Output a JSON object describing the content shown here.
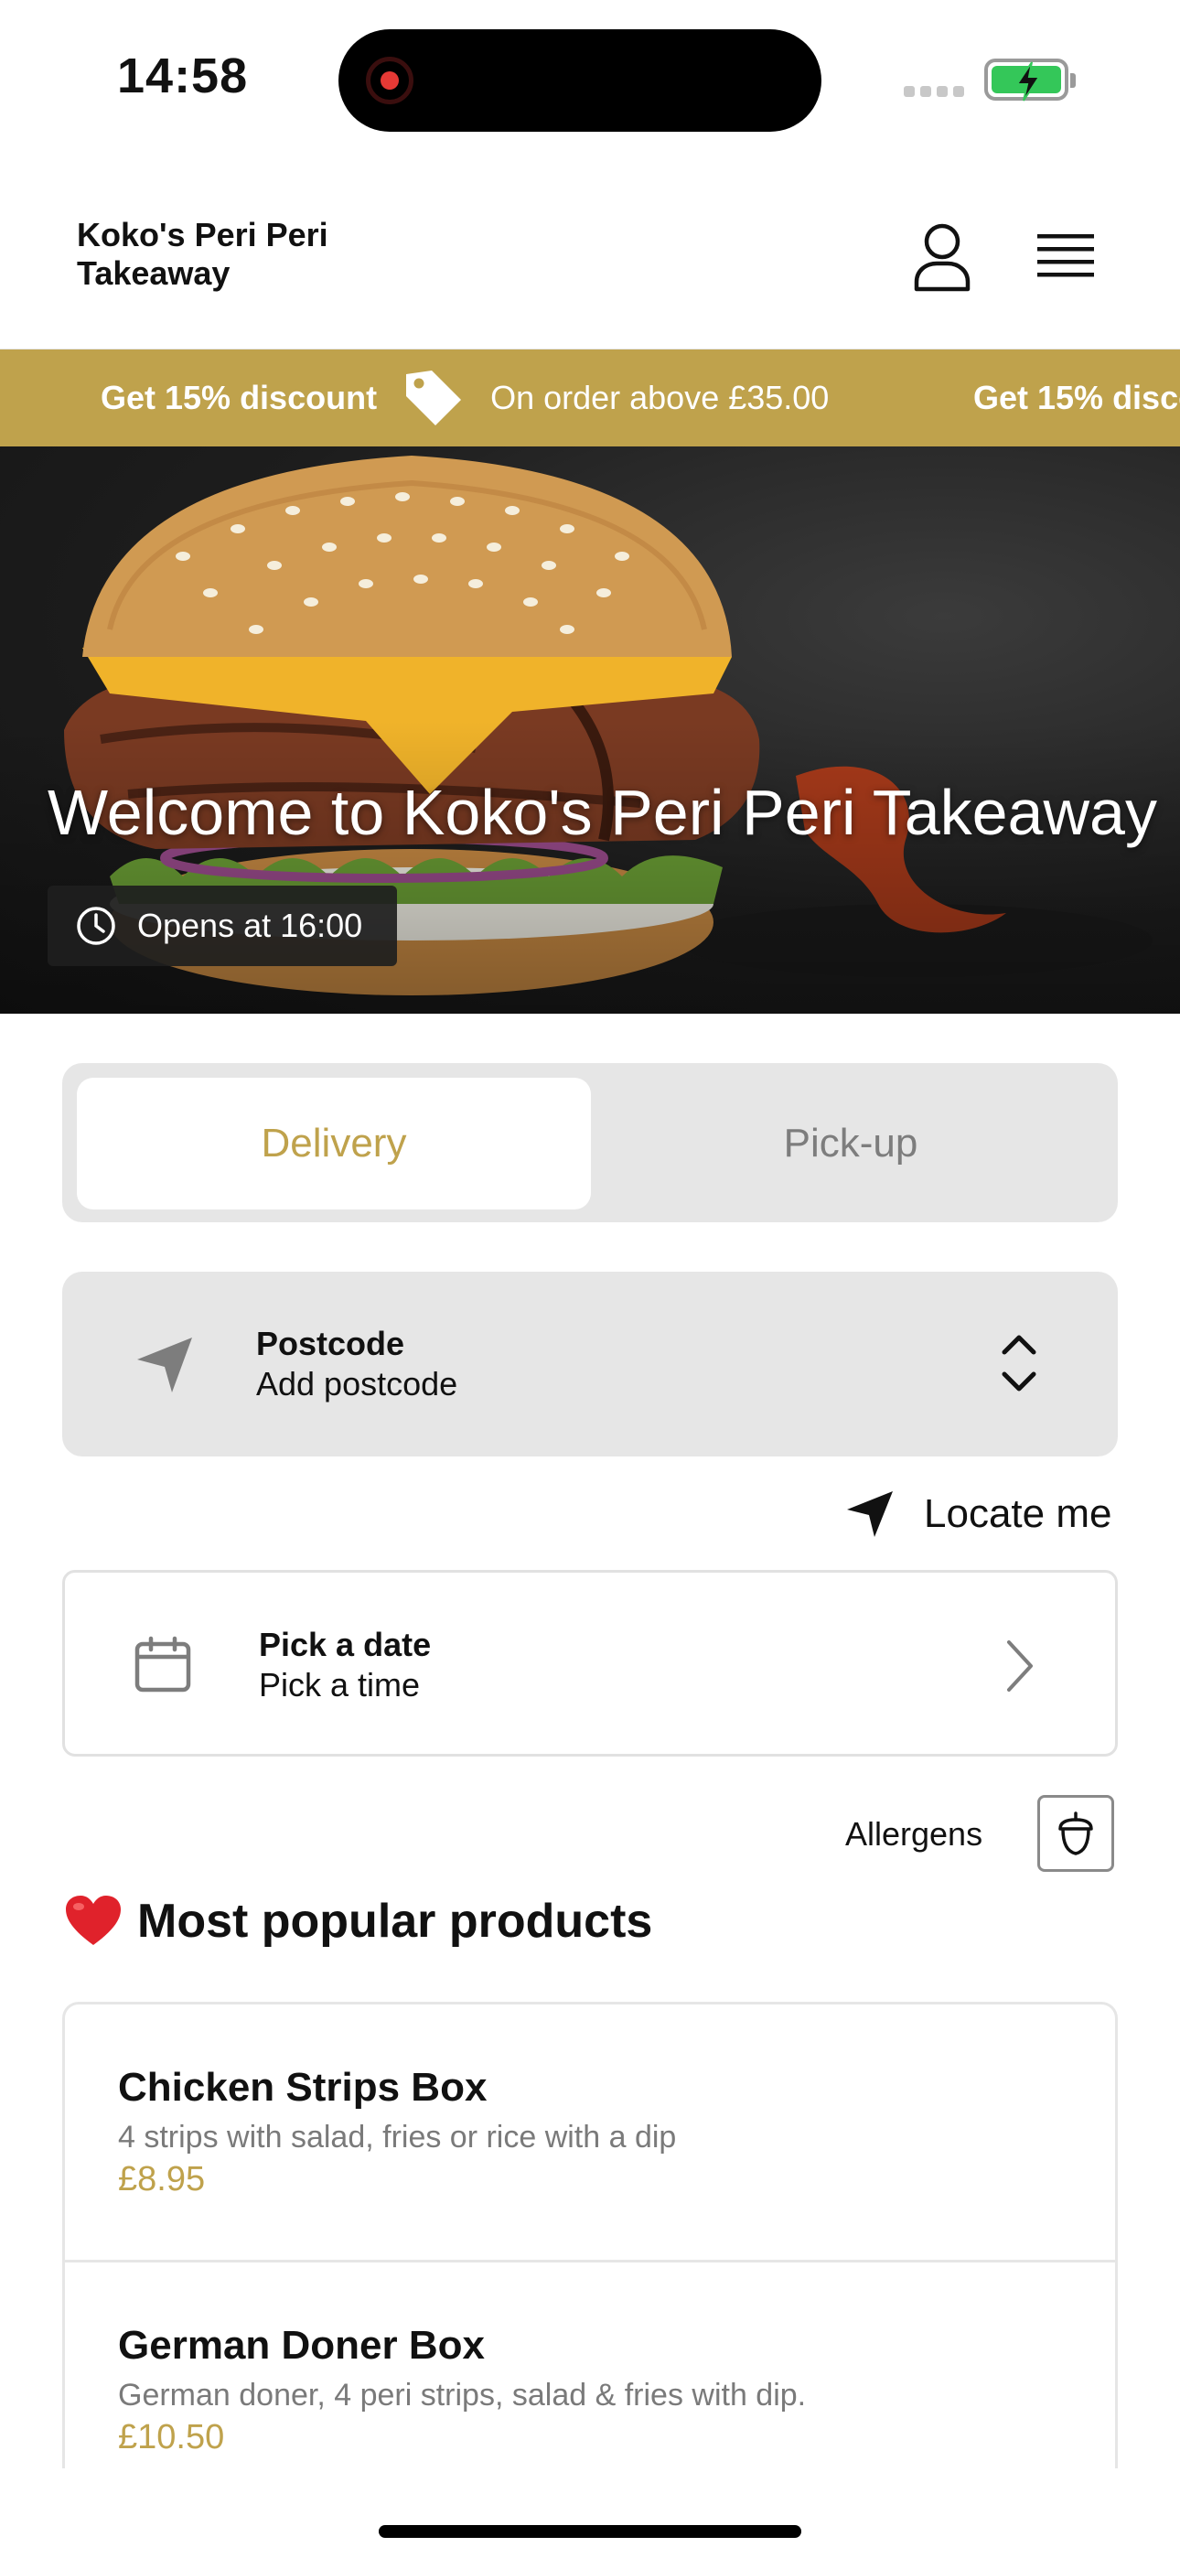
{
  "status_bar": {
    "time": "14:58"
  },
  "header": {
    "brand": "Koko's Peri Peri Takeaway"
  },
  "promo": {
    "items": [
      {
        "bold": "Get 15% discount",
        "text": "On order above £35.00"
      },
      {
        "bold": "Get 15% discount",
        "text": ""
      }
    ]
  },
  "hero": {
    "title": "Welcome to Koko's Peri Peri Takeaway",
    "opens": "Opens at 16:00"
  },
  "mode": {
    "delivery": "Delivery",
    "pickup": "Pick-up",
    "selected": "Delivery"
  },
  "postcode": {
    "label": "Postcode",
    "value": "Add postcode"
  },
  "locate": {
    "label": "Locate me"
  },
  "schedule": {
    "date": "Pick a date",
    "time": "Pick a time"
  },
  "allergens": {
    "label": "Allergens"
  },
  "popular": {
    "title": "Most popular products",
    "products": [
      {
        "name": "Chicken Strips Box",
        "description": "4 strips with salad, fries or rice with a dip",
        "price": "£8.95"
      },
      {
        "name": "German Doner Box",
        "description": "German doner, 4 peri strips, salad & fries with dip.",
        "price": "£10.50"
      }
    ]
  },
  "colors": {
    "accent": "#bfa24c",
    "panel": "#e6e6e6"
  },
  "icons": [
    "record-icon",
    "battery-icon",
    "user-icon",
    "menu-icon",
    "tag-icon",
    "clock-icon",
    "navigation-icon",
    "chevron-up-down-icon",
    "calendar-icon",
    "chevron-right-icon",
    "acorn-icon",
    "heart-icon"
  ]
}
